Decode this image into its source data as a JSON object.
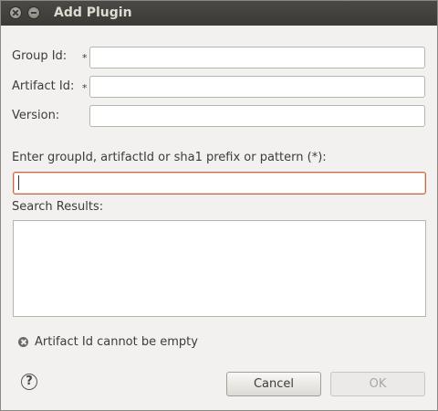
{
  "window": {
    "title": "Add Plugin"
  },
  "form": {
    "group_id_label": "Group Id:",
    "artifact_id_label": "Artifact Id:",
    "version_label": "Version:",
    "required_marker": "*",
    "group_id_value": "",
    "artifact_id_value": "",
    "version_value": ""
  },
  "search": {
    "prompt": "Enter groupId, artifactId or sha1 prefix or pattern (*):",
    "value": "",
    "results_label": "Search Results:"
  },
  "status": {
    "error_message": "Artifact Id cannot be empty"
  },
  "buttons": {
    "help": "?",
    "cancel": "Cancel",
    "ok": "OK"
  }
}
